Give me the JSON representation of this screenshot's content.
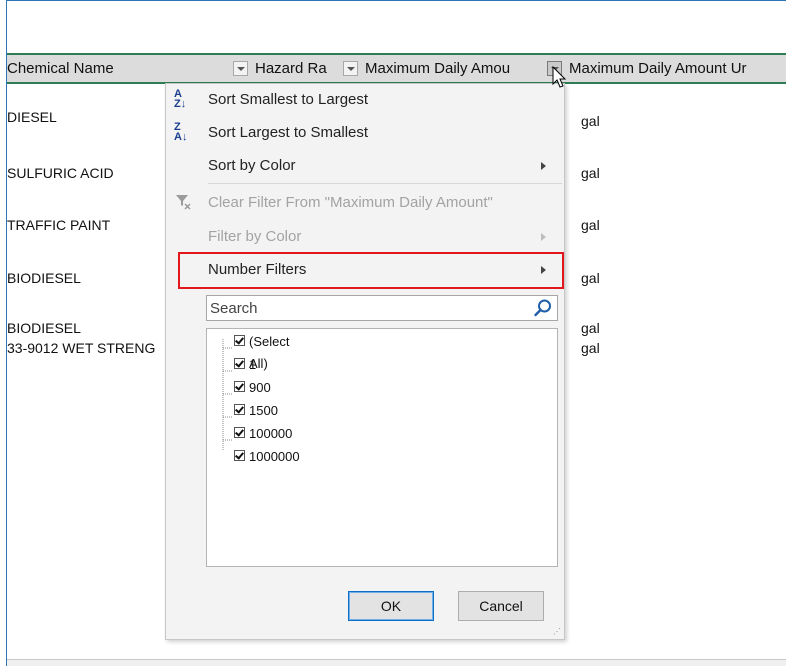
{
  "columns": {
    "chemical_name": "Chemical Name",
    "hazard_rating": "Hazard Ra",
    "max_daily_amount": "Maximum Daily Amou",
    "max_daily_amount_units": "Maximum Daily Amount Ur"
  },
  "rows": [
    {
      "name": "DIESEL",
      "unit": "gal"
    },
    {
      "name": "SULFURIC ACID",
      "unit": "gal"
    },
    {
      "name": "TRAFFIC PAINT",
      "unit": "gal"
    },
    {
      "name": "BIODIESEL",
      "unit": "gal"
    },
    {
      "name": "BIODIESEL",
      "unit": "gal"
    },
    {
      "name": "33-9012 WET STRENG",
      "unit": "gal"
    }
  ],
  "menu": {
    "sort_asc": "Sort Smallest to Largest",
    "sort_desc": "Sort Largest to Smallest",
    "sort_by_color": "Sort by Color",
    "clear_filter": "Clear Filter From \"Maximum Daily Amount\"",
    "filter_by_color": "Filter by Color",
    "number_filters": "Number Filters"
  },
  "search": {
    "placeholder": "Search"
  },
  "list": {
    "items": [
      "(Select All)",
      "1",
      "900",
      "1500",
      "100000",
      "1000000"
    ],
    "checked": [
      true,
      true,
      true,
      true,
      true,
      true
    ]
  },
  "buttons": {
    "ok": "OK",
    "cancel": "Cancel"
  },
  "icons": {
    "sort_asc": "sort-ascending-icon",
    "sort_desc": "sort-descending-icon",
    "clear_filter": "clear-filter-icon",
    "search": "search-icon",
    "submenu": "chevron-right-icon"
  },
  "colors": {
    "header_border": "#2f7d52",
    "highlight_border": "#e2161b",
    "ok_border": "#0f6fc6"
  }
}
